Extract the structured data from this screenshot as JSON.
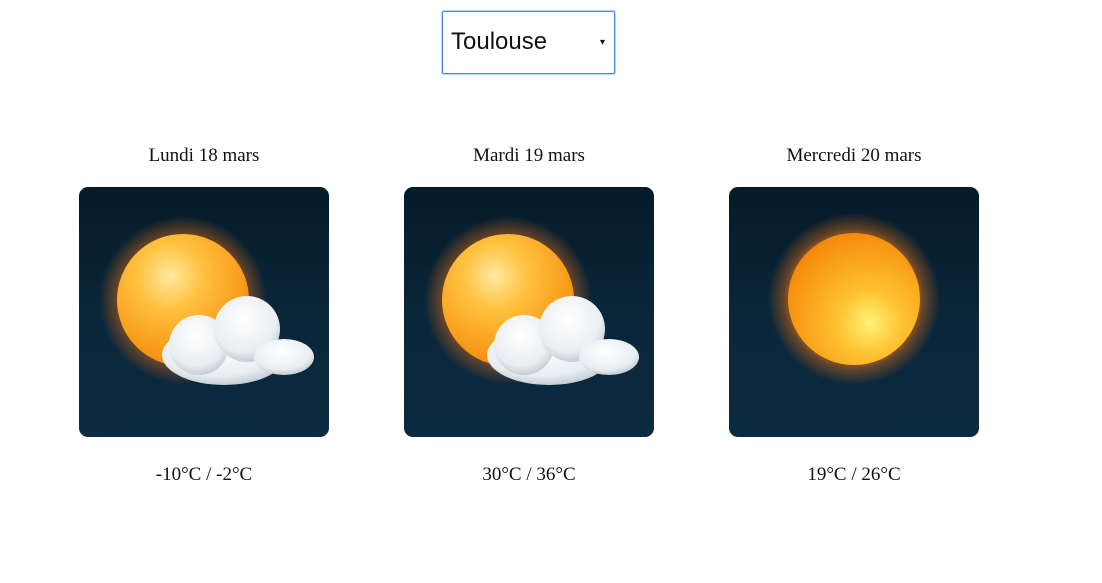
{
  "city_select": {
    "selected": "Toulouse",
    "caret": "▾"
  },
  "days": [
    {
      "title": "Lundi 18 mars",
      "icon": "sun-behind-cloud-icon",
      "temps": "-10°C / -2°C"
    },
    {
      "title": "Mardi 19 mars",
      "icon": "sun-behind-cloud-icon",
      "temps": "30°C / 36°C"
    },
    {
      "title": "Mercredi 20 mars",
      "icon": "sun-icon",
      "temps": "19°C / 26°C"
    }
  ],
  "colors": {
    "tile_bg": "#0a2538",
    "sun": "#ffb020",
    "select_border": "#4a86e8"
  }
}
